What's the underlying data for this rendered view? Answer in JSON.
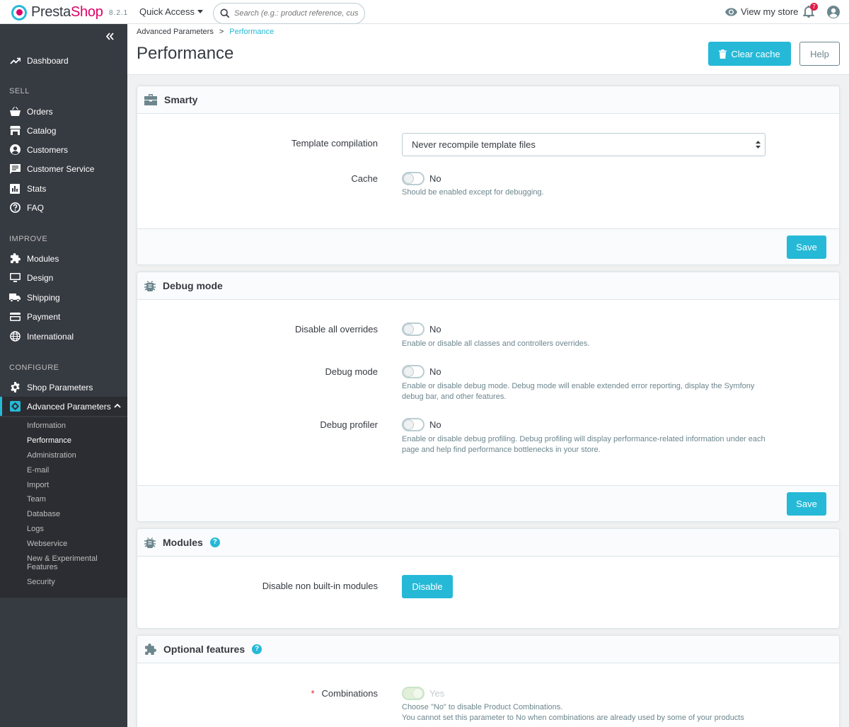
{
  "header": {
    "logo_text_1": "Presta",
    "logo_text_2": "Shop",
    "version": "8.2.1",
    "quick_access": "Quick Access",
    "search_placeholder": "Search (e.g.: product reference, custon",
    "view_store": "View my store",
    "notification_count": "7"
  },
  "sidebar": {
    "dashboard": "Dashboard",
    "sections": {
      "sell": "SELL",
      "improve": "IMPROVE",
      "configure": "CONFIGURE"
    },
    "sell_items": [
      "Orders",
      "Catalog",
      "Customers",
      "Customer Service",
      "Stats",
      "FAQ"
    ],
    "improve_items": [
      "Modules",
      "Design",
      "Shipping",
      "Payment",
      "International"
    ],
    "configure_items": [
      "Shop Parameters",
      "Advanced Parameters"
    ],
    "sub_items": [
      "Information",
      "Performance",
      "Administration",
      "E-mail",
      "Import",
      "Team",
      "Database",
      "Logs",
      "Webservice",
      "New & Experimental Features",
      "Security"
    ]
  },
  "page": {
    "breadcrumb_parent": "Advanced Parameters",
    "breadcrumb_sep": ">",
    "breadcrumb_current": "Performance",
    "title": "Performance",
    "clear_cache": "Clear cache",
    "help": "Help"
  },
  "smarty": {
    "title": "Smarty",
    "template_label": "Template compilation",
    "template_value": "Never recompile template files",
    "cache_label": "Cache",
    "cache_value": "No",
    "cache_help": "Should be enabled except for debugging.",
    "save": "Save"
  },
  "debug": {
    "title": "Debug mode",
    "overrides_label": "Disable all overrides",
    "overrides_value": "No",
    "overrides_help": "Enable or disable all classes and controllers overrides.",
    "debug_label": "Debug mode",
    "debug_value": "No",
    "debug_help": "Enable or disable debug mode. Debug mode will enable extended error reporting, display the Symfony debug bar, and other features.",
    "profiler_label": "Debug profiler",
    "profiler_value": "No",
    "profiler_help": "Enable or disable debug profiling. Debug profiling will display performance-related information under each page and help find performance bottlenecks in your store.",
    "save": "Save"
  },
  "modules": {
    "title": "Modules",
    "help_mark": "?",
    "disable_label": "Disable non built-in modules",
    "disable_button": "Disable"
  },
  "optional": {
    "title": "Optional features",
    "help_mark": "?",
    "required_mark": "*",
    "combinations_label": "Combinations",
    "combinations_value": "Yes",
    "combinations_help_1": "Choose \"No\" to disable Product Combinations.",
    "combinations_help_2": "You cannot set this parameter to No when combinations are already used by some of your products"
  },
  "colors": {
    "accent": "#25b9d7",
    "sidebar": "#363a41",
    "text": "#363a41"
  }
}
